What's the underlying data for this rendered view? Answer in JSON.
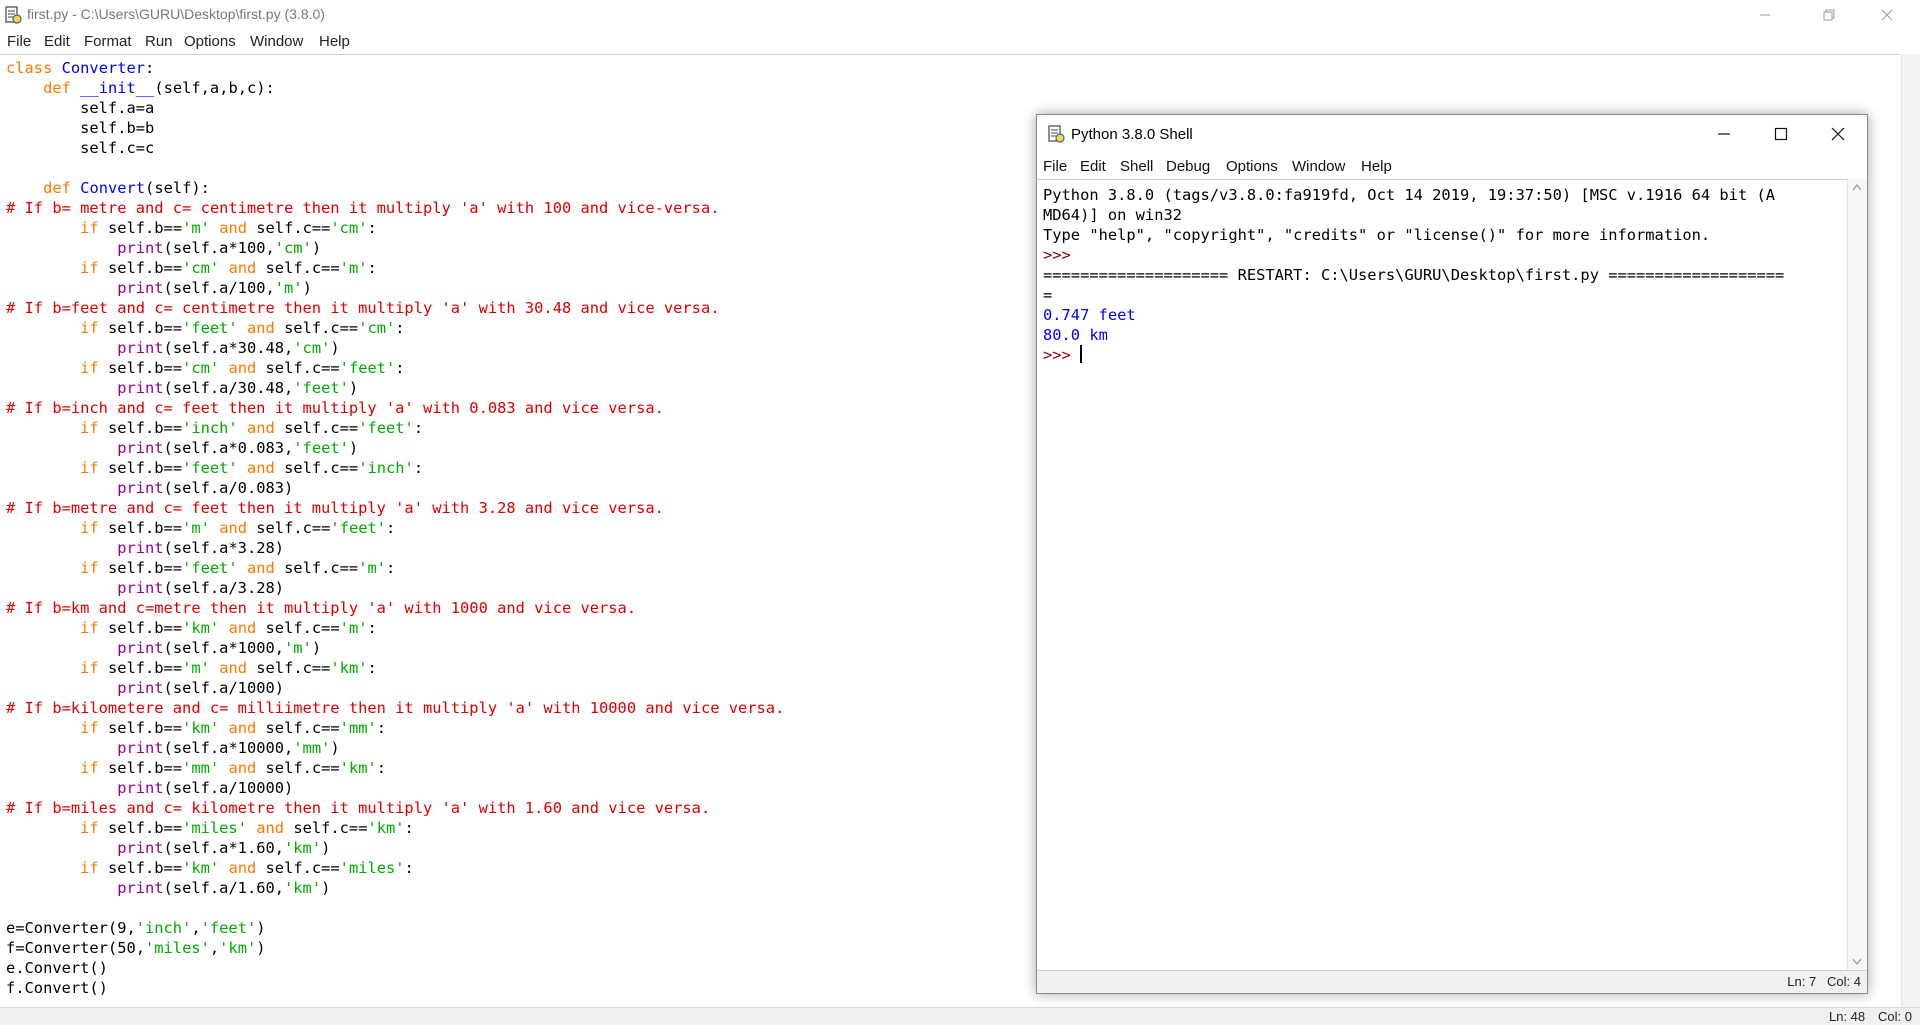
{
  "editor": {
    "title": "first.py - C:\\Users\\GURU\\Desktop\\first.py (3.8.0)",
    "menu": [
      "File",
      "Edit",
      "Format",
      "Run",
      "Options",
      "Window",
      "Help"
    ],
    "status": {
      "ln": "Ln: 48",
      "col": "Col: 0"
    },
    "code_lines": [
      "class Converter:",
      "    def __init__(self,a,b,c):",
      "        self.a=a",
      "        self.b=b",
      "        self.c=c",
      "",
      "    def Convert(self):",
      "# If b= metre and c= centimetre then it multiply 'a' with 100 and vice-versa.",
      "        if self.b=='m' and self.c=='cm':",
      "            print(self.a*100,'cm')",
      "        if self.b=='cm' and self.c=='m':",
      "            print(self.a/100,'m')",
      "# If b=feet and c= centimetre then it multiply 'a' with 30.48 and vice versa.",
      "        if self.b=='feet' and self.c=='cm':",
      "            print(self.a*30.48,'cm')",
      "        if self.b=='cm' and self.c=='feet':",
      "            print(self.a/30.48,'feet')",
      "# If b=inch and c= feet then it multiply 'a' with 0.083 and vice versa.",
      "        if self.b=='inch' and self.c=='feet':",
      "            print(self.a*0.083,'feet')",
      "        if self.b=='feet' and self.c=='inch':",
      "            print(self.a/0.083)",
      "# If b=metre and c= feet then it multiply 'a' with 3.28 and vice versa.",
      "        if self.b=='m' and self.c=='feet':",
      "            print(self.a*3.28)",
      "        if self.b=='feet' and self.c=='m':",
      "            print(self.a/3.28)",
      "# If b=km and c=metre then it multiply 'a' with 1000 and vice versa.",
      "        if self.b=='km' and self.c=='m':",
      "            print(self.a*1000,'m')",
      "        if self.b=='m' and self.c=='km':",
      "            print(self.a/1000)",
      "# If b=kilometere and c= milliimetre then it multiply 'a' with 10000 and vice versa.",
      "        if self.b=='km' and self.c=='mm':",
      "            print(self.a*10000,'mm')",
      "        if self.b=='mm' and self.c=='km':",
      "            print(self.a/10000)",
      "# If b=miles and c= kilometre then it multiply 'a' with 1.60 and vice versa.",
      "        if self.b=='miles' and self.c=='km':",
      "            print(self.a*1.60,'km')",
      "        if self.b=='km' and self.c=='miles':",
      "            print(self.a/1.60,'km')",
      "",
      "e=Converter(9,'inch','feet')",
      "f=Converter(50,'miles','km')",
      "e.Convert()",
      "f.Convert()"
    ]
  },
  "shell": {
    "title": "Python 3.8.0 Shell",
    "menu": [
      "File",
      "Edit",
      "Shell",
      "Debug",
      "Options",
      "Window",
      "Help"
    ],
    "lines": [
      "Python 3.8.0 (tags/v3.8.0:fa919fd, Oct 14 2019, 19:37:50) [MSC v.1916 64 bit (A",
      "MD64)] on win32",
      "Type \"help\", \"copyright\", \"credits\" or \"license()\" for more information.",
      ">>> ",
      "==================== RESTART: C:\\Users\\GURU\\Desktop\\first.py ===================",
      "="
    ],
    "output": [
      "0.747 feet",
      "80.0 km"
    ],
    "prompt": ">>> ",
    "status": {
      "ln": "Ln: 7",
      "col": "Col: 4"
    }
  },
  "colors": {
    "keyword": "#ff7700",
    "definition": "#0000ff",
    "builtin": "#900090",
    "string": "#00aa00",
    "comment": "#dd0000",
    "shell_output": "#0000ff"
  }
}
